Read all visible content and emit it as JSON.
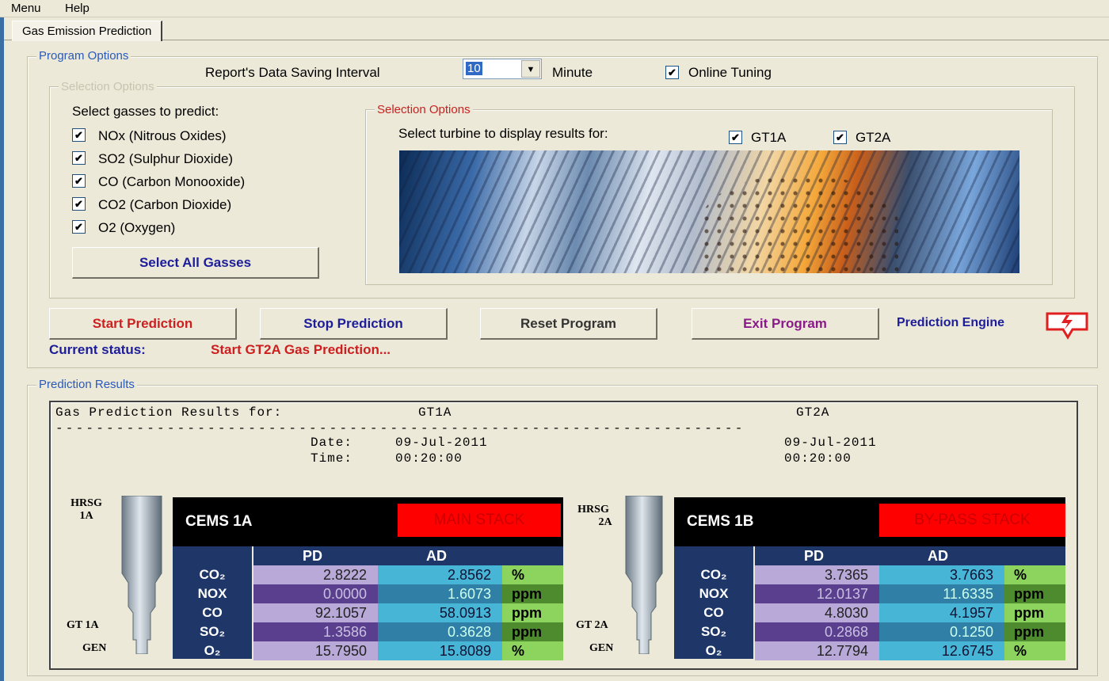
{
  "menu": {
    "items": [
      "Menu",
      "Help"
    ]
  },
  "tab": {
    "label": "Gas Emission Prediction"
  },
  "program_options": {
    "legend": "Program Options",
    "interval_label": "Report's Data Saving Interval",
    "interval_value": "10",
    "interval_unit": "Minute",
    "online_tuning_label": "Online Tuning",
    "gas_selection": {
      "legend": "Selection Options",
      "prompt": "Select gasses to predict:",
      "gases": [
        "NOx  (Nitrous Oxides)",
        "SO2  (Sulphur Dioxide)",
        "CO  (Carbon Monooxide)",
        "CO2  (Carbon Dioxide)",
        "O2  (Oxygen)"
      ],
      "select_all_label": "Select All Gasses"
    },
    "turbine_selection": {
      "legend": "Selection Options",
      "prompt": "Select turbine to display results for:",
      "turbines": [
        "GT1A",
        "GT2A"
      ]
    },
    "buttons": {
      "start": "Start Prediction",
      "stop": "Stop Prediction",
      "reset": "Reset Program",
      "exit": "Exit Program"
    },
    "engine_label": "Prediction Engine",
    "status_label": "Current status:",
    "status_value": "Start GT2A Gas Prediction..."
  },
  "results": {
    "legend": "Prediction Results",
    "header_label": "Gas Prediction Results for:",
    "turbine1": "GT1A",
    "turbine2": "GT2A",
    "separator": "--------------------------------------------------------------------",
    "date_label": "Date:",
    "time_label": "Time:",
    "date1": "09-Jul-2011",
    "time1": "00:20:00",
    "date2": "09-Jul-2011",
    "time2": "00:20:00",
    "col_pd": "PD",
    "col_ad": "AD",
    "panel1": {
      "hrsg": [
        "HRSG",
        "1A"
      ],
      "gt": "GT 1A",
      "gen": "GEN",
      "cems": "CEMS 1A",
      "stack": "MAIN STACK",
      "rows": [
        {
          "gas": "CO₂",
          "pd": "2.8222",
          "ad": "2.8562",
          "unit": "%"
        },
        {
          "gas": "NOX",
          "pd": "0.0000",
          "ad": "1.6073",
          "unit": "ppm"
        },
        {
          "gas": "CO",
          "pd": "92.1057",
          "ad": "58.0913",
          "unit": "ppm"
        },
        {
          "gas": "SO₂",
          "pd": "1.3586",
          "ad": "0.3628",
          "unit": "ppm"
        },
        {
          "gas": "O₂",
          "pd": "15.7950",
          "ad": "15.8089",
          "unit": "%"
        }
      ]
    },
    "panel2": {
      "hrsg": [
        "HRSG",
        "2A"
      ],
      "gt": "GT 2A",
      "gen": "GEN",
      "cems": "CEMS 1B",
      "stack": "BY-PASS STACK",
      "rows": [
        {
          "gas": "CO₂",
          "pd": "3.7365",
          "ad": "3.7663",
          "unit": "%"
        },
        {
          "gas": "NOX",
          "pd": "12.0137",
          "ad": "11.6335",
          "unit": "ppm"
        },
        {
          "gas": "CO",
          "pd": "4.8030",
          "ad": "4.1957",
          "unit": "ppm"
        },
        {
          "gas": "SO₂",
          "pd": "0.2868",
          "ad": "0.1250",
          "unit": "ppm"
        },
        {
          "gas": "O₂",
          "pd": "12.7794",
          "ad": "12.6745",
          "unit": "%"
        }
      ]
    }
  },
  "colors": {
    "start": "#cc1f1f",
    "stop": "#1d1d9a",
    "reset": "#222222",
    "exit": "#8a1a8a",
    "engine": "#1d1d9a",
    "status_label": "#1d1d9a",
    "status_value": "#cc1f1f",
    "legend": "#2a5ab8"
  }
}
